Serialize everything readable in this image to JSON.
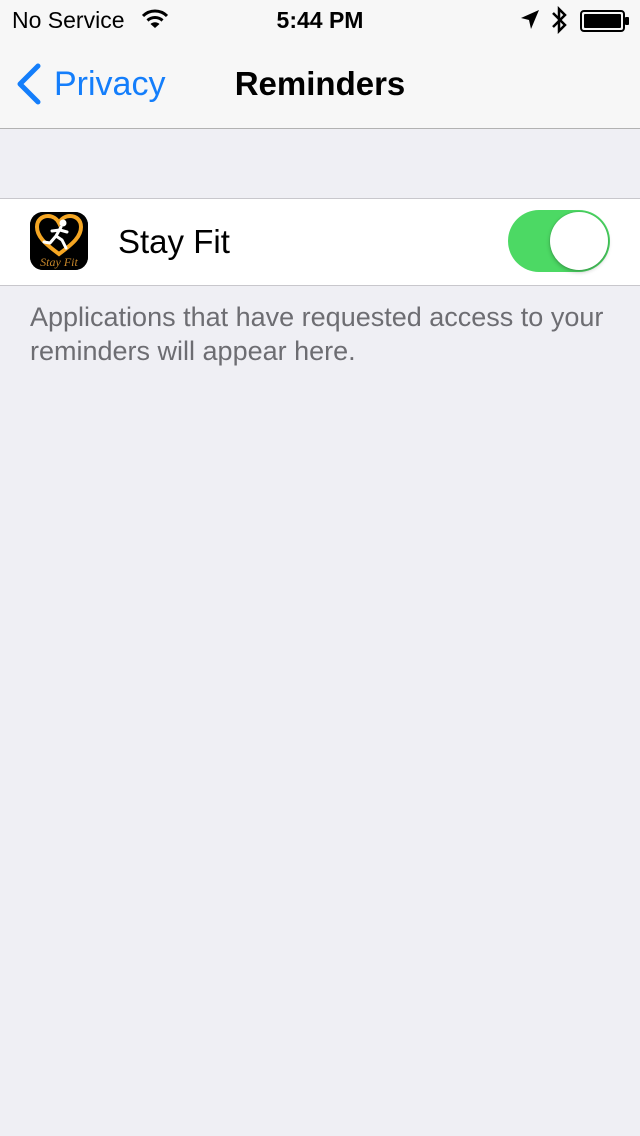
{
  "status_bar": {
    "carrier": "No Service",
    "time": "5:44 PM"
  },
  "nav": {
    "back_label": "Privacy",
    "title": "Reminders"
  },
  "apps": [
    {
      "name": "Stay Fit",
      "icon_text": "Stay Fit",
      "access_enabled": true
    }
  ],
  "footer": "Applications that have requested access to your reminders will appear here.",
  "colors": {
    "accent": "#147efb",
    "toggle_on": "#4cd964",
    "background": "#efeff4",
    "footer_text": "#6d6d72"
  },
  "icons": [
    "wifi-icon",
    "location-arrow-icon",
    "bluetooth-icon",
    "battery-icon",
    "chevron-left-icon",
    "stay-fit-app-icon"
  ]
}
